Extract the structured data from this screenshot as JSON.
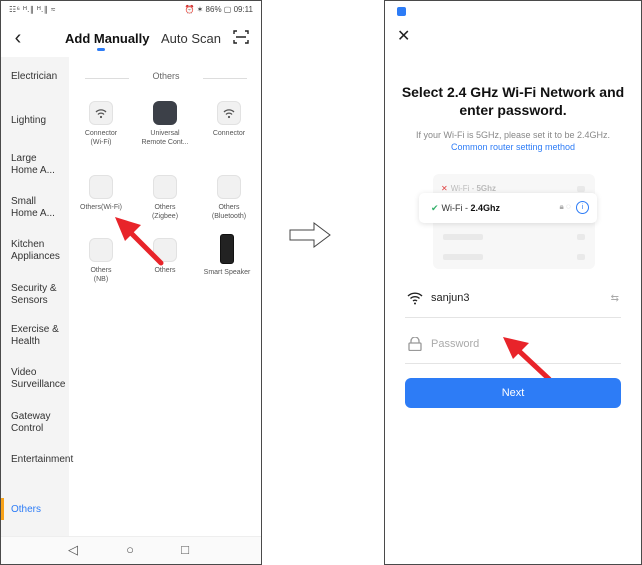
{
  "left": {
    "status": {
      "left": "☷⁶ ᴴ.∥ ᴴ.∥ ≈",
      "right": "⏰ ✶ 86% ▢ 09:11"
    },
    "tabs": {
      "manual": "Add Manually",
      "auto": "Auto Scan"
    },
    "section_title": "Others",
    "sidebar": [
      "Electrician",
      "Lighting",
      "Large Home A...",
      "Small Home A...",
      "Kitchen Appliances",
      "Security & Sensors",
      "Exercise & Health",
      "Video Surveillance",
      "Gateway Control",
      "Entertainment",
      "Others"
    ],
    "devices": [
      {
        "label": "Connector\n(Wi-Fi)",
        "icon": "wifi-icon"
      },
      {
        "label": "Universal\nRemote Cont...",
        "icon": "remote-icon"
      },
      {
        "label": "Connector",
        "icon": "wifi-icon"
      },
      {
        "label": "Others(Wi-Fi)",
        "icon": "blank-device-icon"
      },
      {
        "label": "Others\n(Zigbee)",
        "icon": "blank-device-icon"
      },
      {
        "label": "Others\n(Bluetooth)",
        "icon": "blank-device-icon"
      },
      {
        "label": "Others\n(NB)",
        "icon": "blank-device-icon"
      },
      {
        "label": "Others",
        "icon": "blank-device-icon"
      },
      {
        "label": "Smart Speaker",
        "icon": "speaker-icon"
      }
    ]
  },
  "right": {
    "title": "Select 2.4 GHz Wi-Fi Network and enter password.",
    "desc": "If your Wi-Fi is 5GHz, please set it to be 2.4GHz.",
    "desc_link": "Common router setting method",
    "wifi_5g_prefix": "Wi-Fi - ",
    "wifi_5g_band": "5Ghz",
    "wifi_24_prefix": "Wi-Fi - ",
    "wifi_24_band": "2.4Ghz",
    "ssid": "sanjun3",
    "password_placeholder": "Password",
    "next_label": "Next"
  },
  "colors": {
    "accent": "#2d7cf6",
    "highlight": "#f7a21a",
    "arrow": "#e8242a"
  }
}
